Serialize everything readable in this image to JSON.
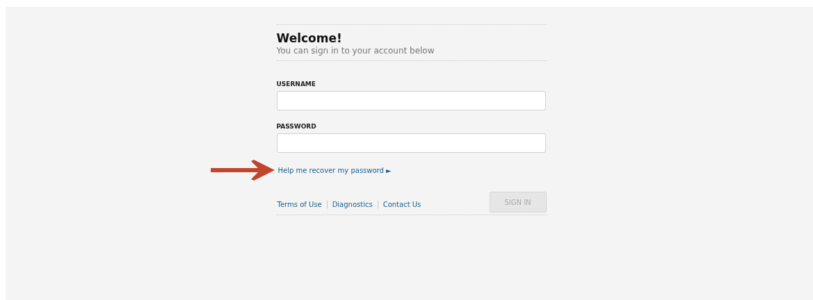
{
  "heading": {
    "title": "Welcome!",
    "subtitle": "You can sign in to your account below"
  },
  "fields": [
    {
      "label": "USERNAME"
    },
    {
      "label": "PASSWORD"
    }
  ],
  "recover_link": {
    "text": "Help me recover my password ►",
    "annotated": true
  },
  "footer_links": [
    "Terms of Use",
    "Diagnostics",
    "Contact Us"
  ],
  "sign_in_button": {
    "label": "SIGN IN",
    "disabled": true
  }
}
